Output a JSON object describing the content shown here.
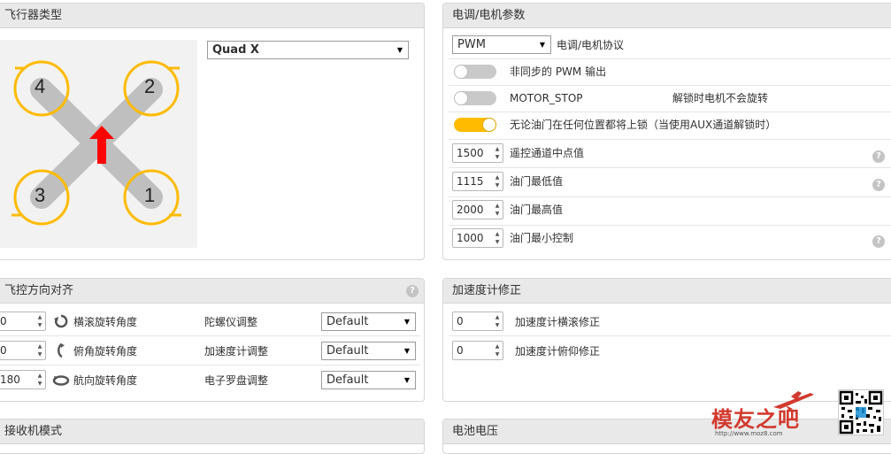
{
  "frame": {
    "title": "飞行器类型",
    "select_value": "Quad X",
    "motor_labels": [
      "4",
      "2",
      "3",
      "1"
    ]
  },
  "esc": {
    "title": "电调/电机参数",
    "protocol_value": "PWM",
    "protocol_label": "电调/电机协议",
    "async_pwm_label": "非同步的 PWM 输出",
    "async_pwm_on": false,
    "motor_stop_label": "MOTOR_STOP",
    "motor_stop_note": "解锁时电机不会旋转",
    "motor_stop_on": false,
    "arm_anywhere_label": "无论油门在任何位置都将上锁（当使用AUX通道解锁时）",
    "arm_anywhere_on": true,
    "mid_rc_value": "1500",
    "mid_rc_label": "遥控通道中点值",
    "min_throttle_value": "1115",
    "min_throttle_label": "油门最低值",
    "max_throttle_value": "2000",
    "max_throttle_label": "油门最高值",
    "min_command_value": "1000",
    "min_command_label": "油门最小控制",
    "help_glyph": "?"
  },
  "board": {
    "title": "飞控方向对齐",
    "roll_value": "0",
    "roll_label": "横滚旋转角度",
    "pitch_value": "0",
    "pitch_label": "俯角旋转角度",
    "yaw_value": "180",
    "yaw_label": "航向旋转角度",
    "gyro_label": "陀螺仪调整",
    "gyro_value": "Default",
    "acc_label": "加速度计调整",
    "acc_value": "Default",
    "mag_label": "电子罗盘调整",
    "mag_value": "Default"
  },
  "acc_trim": {
    "title": "加速度计修正",
    "roll_value": "0",
    "roll_label": "加速度计横滚修正",
    "pitch_value": "0",
    "pitch_label": "加速度计俯仰修正"
  },
  "receiver": {
    "title": "接收机模式"
  },
  "battery": {
    "title": "电池电压"
  },
  "watermark": {
    "brand": "模友之吧",
    "url": "http://www.moz8.com"
  },
  "colors": {
    "accent": "#ffbb00",
    "arrow": "#ff0000",
    "arm": "#bfbfbf"
  }
}
